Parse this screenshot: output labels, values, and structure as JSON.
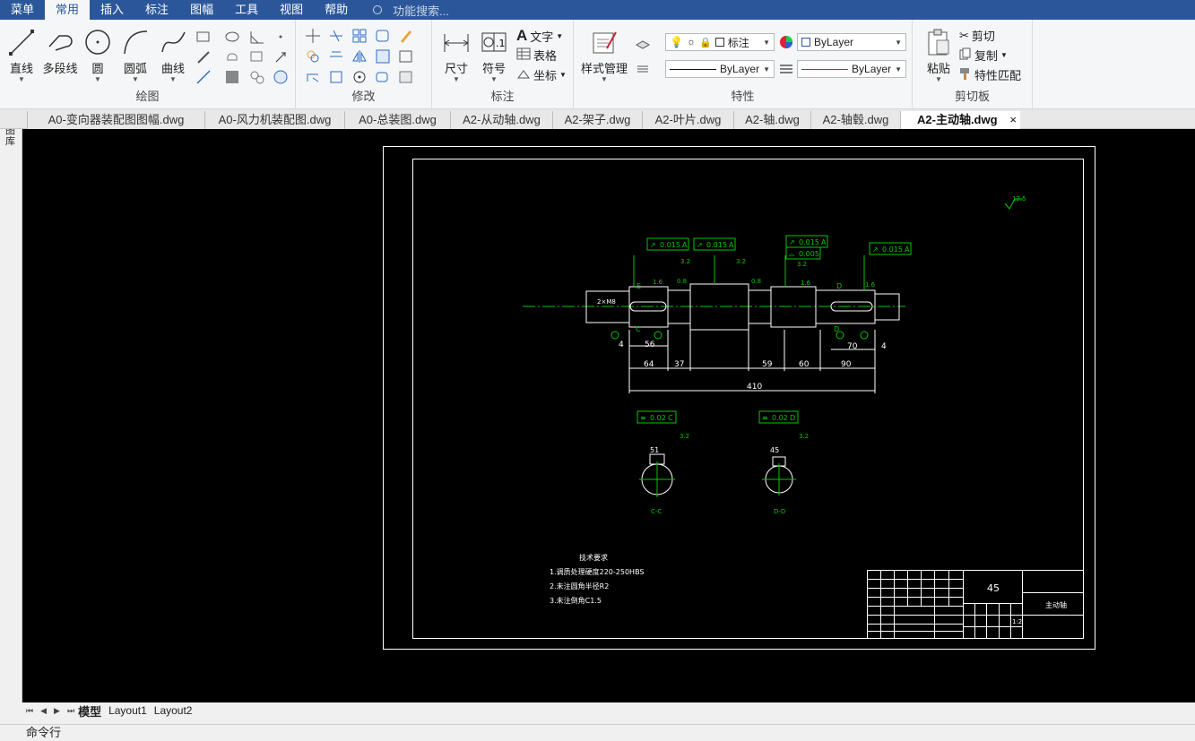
{
  "menu": {
    "items": [
      "菜单",
      "常用",
      "插入",
      "标注",
      "图幅",
      "工具",
      "视图",
      "帮助"
    ],
    "active_index": 1,
    "search_placeholder": "功能搜索..."
  },
  "ribbon": {
    "draw": {
      "label": "绘图",
      "line": "直线",
      "polyline": "多段线",
      "circle": "圆",
      "arc": "圆弧",
      "curve": "曲线"
    },
    "modify": {
      "label": "修改"
    },
    "annotate": {
      "label": "标注",
      "dimension": "尺寸",
      "symbol": "符号",
      "text": "文字",
      "table": "表格",
      "coordinate": "坐标"
    },
    "properties": {
      "label": "特性",
      "style_manager": "样式管理",
      "layer_name": "标注",
      "color": "ByLayer",
      "linetype": "ByLayer",
      "lineweight": "ByLayer",
      "lineweight_color": "#d02020"
    },
    "clipboard": {
      "label": "剪切板",
      "paste": "粘贴",
      "cut": "剪切",
      "copy": "复制",
      "match": "特性匹配"
    }
  },
  "side_panel_label": "图库",
  "doc_tabs": [
    "A0-变向器装配图图幅.dwg",
    "A0-风力机装配图.dwg",
    "A0-总装图.dwg",
    "A2-从动轴.dwg",
    "A2-架子.dwg",
    "A2-叶片.dwg",
    "A2-轴.dwg",
    "A2-轴毂.dwg",
    "A2-主动轴.dwg"
  ],
  "active_doc_index": 8,
  "close_glyph": "×",
  "drawing": {
    "roughness_top": "12.5",
    "tolerance_frames": [
      {
        "sym": "↗",
        "val": "0.015",
        "ref": "A"
      },
      {
        "sym": "↗",
        "val": "0.015",
        "ref": "A"
      },
      {
        "sym": "↗",
        "val": "0.015",
        "ref": "A"
      },
      {
        "sym": "⌓",
        "val": "0.005",
        "ref": ""
      },
      {
        "sym": "↗",
        "val": "0.015",
        "ref": "A"
      }
    ],
    "sec_tol": [
      {
        "sym": "≡",
        "val": "0.02",
        "ref": "C"
      },
      {
        "sym": "≡",
        "val": "0.02",
        "ref": "D"
      }
    ],
    "dims_bottom": [
      "64",
      "37",
      "59",
      "60",
      "90"
    ],
    "dim_total": "410",
    "dims_small": [
      "4",
      "56",
      "70",
      "4"
    ],
    "dims_ext": [
      "2×M8"
    ],
    "roughness_marks": [
      "1.6",
      "0.8",
      "3.2",
      "0.8",
      "1.6",
      "1.6",
      "3.2",
      "3.2",
      "3.2",
      "3.2"
    ],
    "section_labels": [
      "C-C",
      "D-D"
    ],
    "section_dims": [
      "51",
      "45"
    ],
    "datum_labels": [
      "E",
      "D",
      "C",
      "D"
    ],
    "notes_title": "技术要求",
    "notes": [
      "1.调质处理硬度220-250HBS",
      "2.未注圆角半径R2",
      "3.未注倒角C1.5"
    ],
    "title_block": {
      "material": "45",
      "name": "主动轴",
      "scale": "1:2"
    }
  },
  "layout_tabs": [
    "模型",
    "Layout1",
    "Layout2"
  ],
  "active_layout_index": 0,
  "command_label": "命令行",
  "colors": {
    "accent": "#2b579a",
    "canvas": "#000000",
    "green": "#00c800",
    "white": "#ffffff"
  }
}
